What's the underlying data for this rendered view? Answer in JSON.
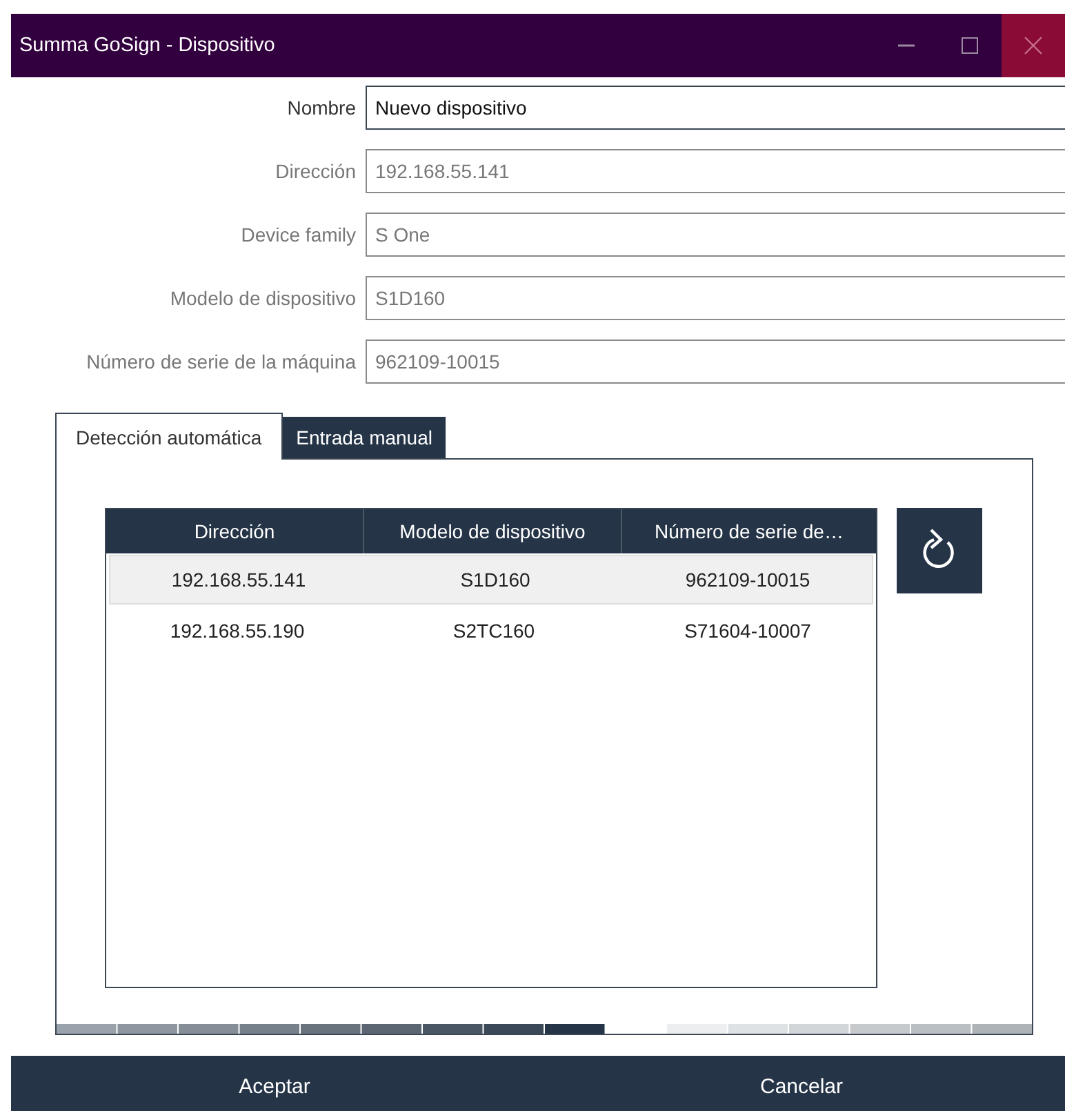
{
  "window": {
    "title": "Summa GoSign - Dispositivo"
  },
  "fields": [
    {
      "label": "Nombre",
      "value": "Nuevo dispositivo",
      "disabled": false
    },
    {
      "label": "Dirección",
      "value": "192.168.55.141",
      "disabled": true
    },
    {
      "label": "Device family",
      "value": "S One",
      "disabled": true
    },
    {
      "label": "Modelo de dispositivo",
      "value": "S1D160",
      "disabled": true
    },
    {
      "label": "Número de serie de la máquina",
      "value": "962109-10015",
      "disabled": true
    }
  ],
  "tabs": [
    {
      "label": "Detección automática",
      "selected": true
    },
    {
      "label": "Entrada manual",
      "selected": false
    }
  ],
  "table": {
    "columns": [
      "Dirección",
      "Modelo de dispositivo",
      "Número de serie de…"
    ],
    "rows": [
      {
        "cells": [
          "192.168.55.141",
          "S1D160",
          "962109-10015"
        ],
        "selected": true
      },
      {
        "cells": [
          "192.168.55.190",
          "S2TC160",
          "S71604-10007"
        ],
        "selected": false
      }
    ]
  },
  "buttons": [
    "Aceptar",
    "Cancelar"
  ]
}
